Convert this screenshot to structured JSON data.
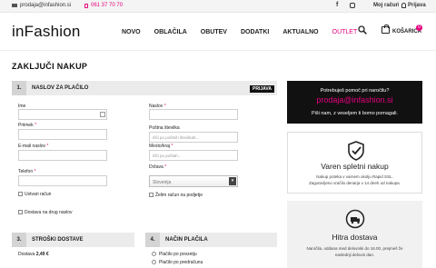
{
  "topbar": {
    "email": "prodaja@infashion.si",
    "phone": "061 37 70 70",
    "account": "Moj račun",
    "login": "Prijava"
  },
  "header": {
    "logo": "inFashion",
    "nav": [
      "NOVO",
      "OBLAČILA",
      "OBUTEV",
      "DODATKI",
      "AKTUALNO",
      "OUTLET"
    ],
    "cart_label": "KOŠARICA",
    "cart_count": "0"
  },
  "page": {
    "title": "ZAKLJUČI NAKUP"
  },
  "address": {
    "num": "1.",
    "title": "NASLOV ZA PLAČILO",
    "login_tag": "PRIJAVA",
    "fields": {
      "ime": "Ime",
      "priimek": "Priimek",
      "email": "E-mail naslov",
      "telefon": "Telefon",
      "naslov": "Naslov",
      "postna": "Poštna številka",
      "postna_placeholder": "Išči po poštnih številkah...",
      "mesto": "Mesto/kraj",
      "mesto_placeholder": "Išči po poštah...",
      "drzava": "Država",
      "drzava_value": "Slovenija"
    },
    "create_account": "Ustvari račun",
    "company_invoice": "Želim račun na podjetje",
    "other_address": "Dostava na drug naslov"
  },
  "shipping": {
    "num": "3.",
    "title": "STROŠKI DOSTAVE",
    "delivery_label": "Dostava",
    "delivery_price": "2,49 €"
  },
  "payment": {
    "num": "4.",
    "title": "NAČIN PLAČILA",
    "options": [
      "Plačilo po povzetju",
      "Plačilo po predračunu"
    ]
  },
  "help": {
    "question": "Potrebuješ pomoč pri naročilu?",
    "email": "prodaja@infashion.si",
    "subtitle": "Piši nam, z veseljem ti bomo pomagali."
  },
  "safe": {
    "title": "Varen spletni nakup",
    "line1": "Nakup poteka v varnem okolju Rapid SSL.",
    "line2": "Zagotovljeno vračilo denarja v 14 dneh od nakupa."
  },
  "fast": {
    "title": "Hitra dostava",
    "line1": "Naročila, oddana med delovniki do 16.00, prejmeš že",
    "line2": "naslednji delovni dan."
  },
  "colors": {
    "accent": "#e5007d",
    "dark": "#111111",
    "panel": "#ebebeb"
  }
}
